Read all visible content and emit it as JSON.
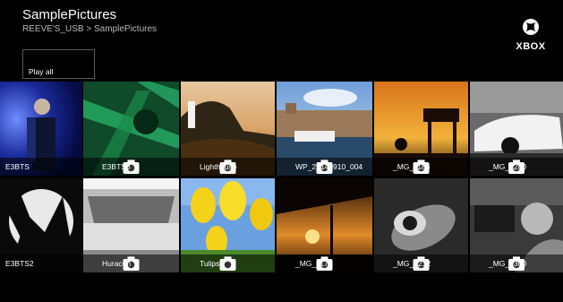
{
  "header": {
    "title": "SamplePictures",
    "breadcrumb": "REEVE'S_USB > SamplePictures",
    "logo_text": "XBOX"
  },
  "actions": {
    "play_all": "Play all"
  },
  "colors": {
    "background": "#000000",
    "selection": "#ffffff",
    "caption_bg": "rgba(0,0,0,0.55)"
  },
  "icons": {
    "camera": "camera-icon",
    "logo": "xbox-logo-icon"
  },
  "pictures": [
    {
      "name": "E3BTS"
    },
    {
      "name": "E3BTS3"
    },
    {
      "name": "Lighthouse"
    },
    {
      "name": "WP_20140910_004"
    },
    {
      "name": "_MG_1186"
    },
    {
      "name": "_MG_1280"
    },
    {
      "name": "E3BTS2"
    },
    {
      "name": "Huracon"
    },
    {
      "name": "Tulips"
    },
    {
      "name": "_MG_1178"
    },
    {
      "name": "_MG_1212"
    },
    {
      "name": "_MG_1300"
    }
  ]
}
